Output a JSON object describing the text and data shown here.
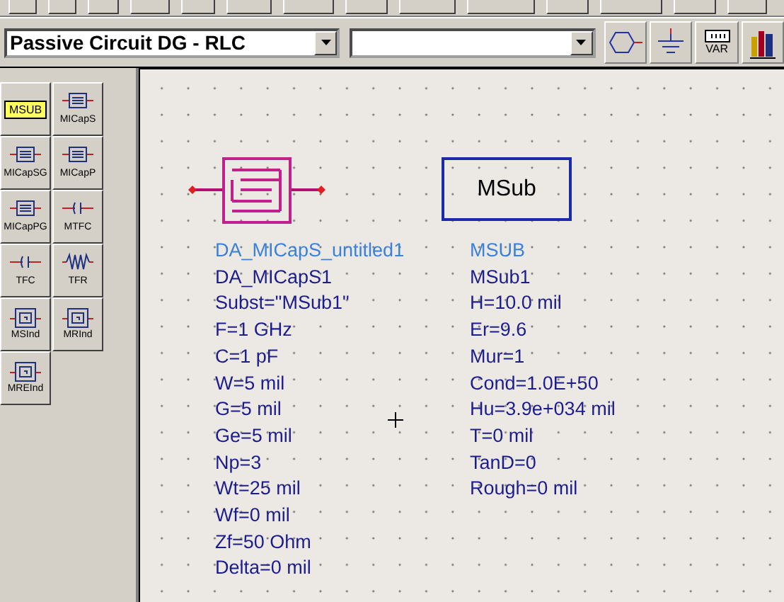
{
  "toolbar": {
    "library_dropdown": {
      "value": "Passive Circuit DG - RLC"
    },
    "buttons": [
      {
        "kind": "port"
      },
      {
        "kind": "ground"
      },
      {
        "kind": "var",
        "label": "VAR"
      },
      {
        "kind": "library"
      }
    ]
  },
  "palette": {
    "items": [
      {
        "kind": "substrate",
        "label": "MSUB"
      },
      {
        "kind": "capacitor",
        "label": "MICapS"
      },
      {
        "kind": "capacitor",
        "label": "MICapSG"
      },
      {
        "kind": "capacitor",
        "label": "MICapP"
      },
      {
        "kind": "capacitor",
        "label": "MICapPG"
      },
      {
        "kind": "thinfilm",
        "label": "MTFC"
      },
      {
        "kind": "thinfilm",
        "label": "TFC"
      },
      {
        "kind": "resistor",
        "label": "TFR"
      },
      {
        "kind": "inductor",
        "label": "MSInd"
      },
      {
        "kind": "inductor",
        "label": "MRInd"
      },
      {
        "kind": "inductor",
        "label": "MREInd"
      }
    ]
  },
  "canvas": {
    "components": [
      {
        "kind": "capacitor",
        "type_name": "DA_MICapS_untitled1",
        "instance_name": "DA_MICapS1",
        "params": [
          "Subst=\"MSub1\"",
          "F=1 GHz",
          "C=1 pF",
          "W=5 mil",
          "G=5 mil",
          "Ge=5 mil",
          "Np=3",
          "Wt=25 mil",
          "Wf=0 mil",
          "Zf=50 Ohm",
          "Delta=0 mil"
        ]
      },
      {
        "kind": "substrate",
        "label": "MSub",
        "type_name": "MSUB",
        "instance_name": "MSub1",
        "params": [
          "H=10.0 mil",
          "Er=9.6",
          "Mur=1",
          "Cond=1.0E+50",
          "Hu=3.9e+034 mil",
          "T=0 mil",
          "TanD=0",
          "Rough=0 mil"
        ]
      }
    ]
  }
}
